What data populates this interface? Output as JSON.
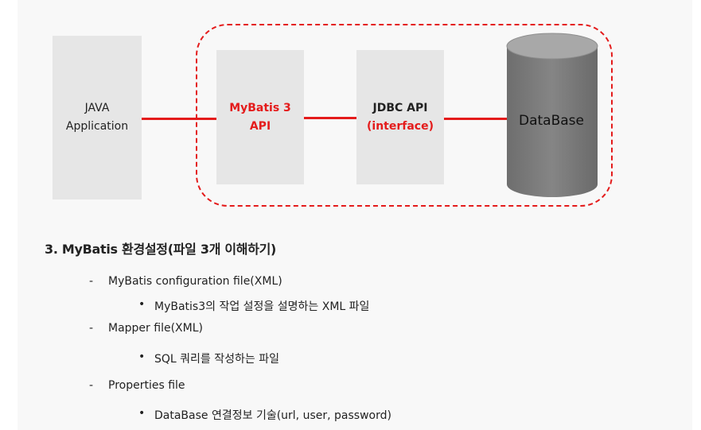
{
  "diagram": {
    "java_box": {
      "line1": "JAVA",
      "line2": "Application"
    },
    "mybatis_box": {
      "line1": "MyBatis 3",
      "line2": "API"
    },
    "jdbc_box": {
      "line1": "JDBC API",
      "line2": "(interface)"
    },
    "database": {
      "label": "DataBase"
    },
    "colors": {
      "accent": "#e41b1b",
      "box": "#e6e6e6",
      "cylinder": "#7f7f7f"
    }
  },
  "section": {
    "heading": "3. MyBatis 환경설정(파일 3개 이해하기)",
    "items": [
      {
        "dash": "-",
        "label": "MyBatis configuration file(XML)",
        "bullet": "MyBatis3의 작업 설정을 설명하는 XML 파일"
      },
      {
        "dash": "-",
        "label": "Mapper file(XML)",
        "bullet": "SQL 쿼리를 작성하는 파일"
      },
      {
        "dash": "-",
        "label": "Properties file",
        "bullet": "DataBase 연결정보 기술(url, user, password)"
      }
    ],
    "bullet_symbol": "•"
  }
}
